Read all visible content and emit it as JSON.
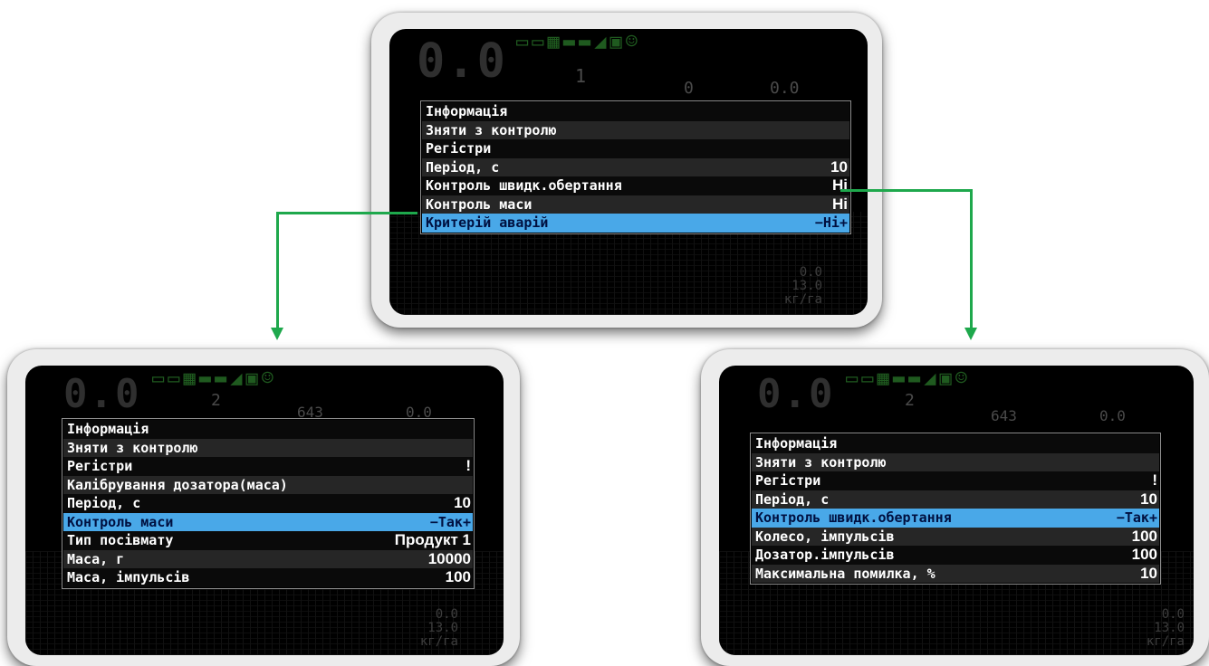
{
  "panels": {
    "top": {
      "bg": {
        "speed": "0.0",
        "num1": "1",
        "num2": "0",
        "num3": "0.0",
        "side": [
          "0.0",
          "13.0"
        ],
        "unit": "кг/га"
      },
      "menu": [
        {
          "label": "Інформація",
          "value": "",
          "selected": false
        },
        {
          "label": "Зняти з контролю",
          "value": "",
          "selected": false
        },
        {
          "label": "Регістри",
          "value": "",
          "selected": false
        },
        {
          "label": "Період, с",
          "value": "10",
          "selected": false
        },
        {
          "label": "Контроль швидк.обертання",
          "value": "Ні",
          "selected": false
        },
        {
          "label": "Контроль маси",
          "value": "Ні",
          "selected": false
        },
        {
          "label": "Критерій аварій",
          "value": "−Ні+",
          "selected": true
        }
      ]
    },
    "left": {
      "bg": {
        "speed": "0.0",
        "num1": "2",
        "num2": "643",
        "num3": "0.0",
        "side": [
          "0.0",
          "13.0"
        ],
        "unit": "кг/га"
      },
      "menu": [
        {
          "label": "Інформація",
          "value": "",
          "selected": false
        },
        {
          "label": "Зняти з контролю",
          "value": "",
          "selected": false
        },
        {
          "label": "Регістри",
          "value": "!",
          "selected": false
        },
        {
          "label": "Калібрування дозатора(маса)",
          "value": "",
          "selected": false
        },
        {
          "label": "Період, с",
          "value": "10",
          "selected": false
        },
        {
          "label": "Контроль маси",
          "value": "−Так+",
          "selected": true
        },
        {
          "label": "Тип посівмату",
          "value": "Продукт 1",
          "selected": false
        },
        {
          "label": "Маса, г",
          "value": "10000",
          "selected": false
        },
        {
          "label": "Маса, імпульсів",
          "value": "100",
          "selected": false
        }
      ]
    },
    "right": {
      "bg": {
        "speed": "0.0",
        "num1": "2",
        "num2": "643",
        "num3": "0.0",
        "side": [
          "0.0",
          "13.0"
        ],
        "unit": "кг/га"
      },
      "menu": [
        {
          "label": "Інформація",
          "value": "",
          "selected": false
        },
        {
          "label": "Зняти з контролю",
          "value": "",
          "selected": false
        },
        {
          "label": "Регістри",
          "value": "!",
          "selected": false
        },
        {
          "label": "Період, с",
          "value": "10",
          "selected": false
        },
        {
          "label": "Контроль швидк.обертання",
          "value": "−Так+",
          "selected": true
        },
        {
          "label": "Колесо, імпульсів",
          "value": "100",
          "selected": false
        },
        {
          "label": "Дозатор.імпульсів",
          "value": "100",
          "selected": false
        },
        {
          "label": "Максимальна помилка, %",
          "value": "10",
          "selected": false
        }
      ]
    }
  },
  "colors": {
    "connector": "#1ea84c",
    "selected_row": "#49a8e8",
    "device_frame": "#ececec"
  }
}
